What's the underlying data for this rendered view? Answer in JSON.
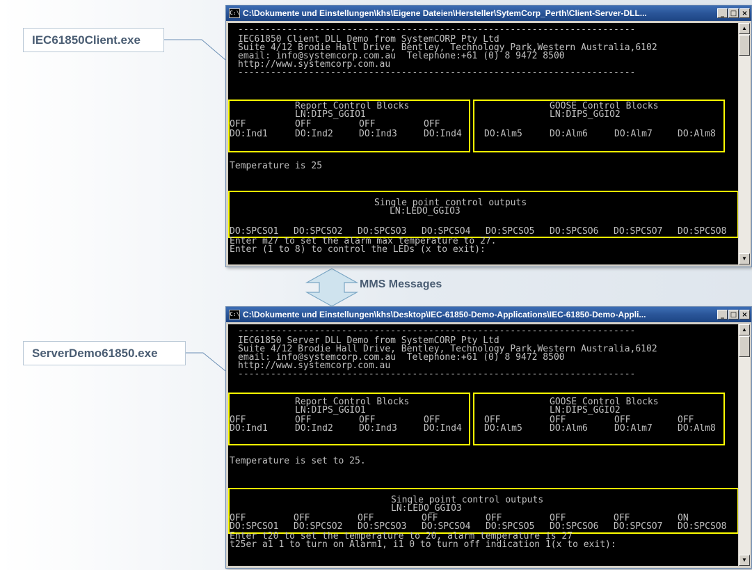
{
  "labels": {
    "client": "IEC61850Client.exe",
    "server": "ServerDemo61850.exe",
    "mms": "MMS Messages"
  },
  "client_window": {
    "title": "C:\\Dokumente und Einstellungen\\khs\\Eigene Dateien\\Hersteller\\SytemCorp_Perth\\Client-Server-DLL...",
    "separator": "-------------------------------------------------------------------------",
    "header": [
      "IEC61850 Client DLL Demo from SystemCORP Pty Ltd",
      "Suite 4/12 Brodie Hall Drive, Bentley, Technology Park,Western Australia,6102",
      "email: info@systemcorp.com.au  Telephone:+61 (0) 8 9472 8500",
      "http://www.systemcorp.com.au"
    ],
    "report_title": "Report Control Blocks",
    "report_ln": "LN:DIPS_GGIO1",
    "report_states": [
      "OFF",
      "OFF",
      "OFF",
      "OFF"
    ],
    "report_dos": [
      "DO:Ind1",
      "DO:Ind2",
      "DO:Ind3",
      "DO:Ind4"
    ],
    "goose_title": "GOOSE Control Blocks",
    "goose_ln": "LN:DIPS_GGIO2",
    "goose_states": [
      "",
      "",
      "",
      ""
    ],
    "goose_dos": [
      "DO:Alm5",
      "DO:Alm6",
      "DO:Alm7",
      "DO:Alm8"
    ],
    "temperature": "Temperature is 25",
    "spc_title": "Single point control outputs",
    "spc_ln": "LN:LEDO_GGIO3",
    "spc_states": [
      "",
      "",
      "",
      "",
      "",
      "",
      "",
      ""
    ],
    "spc_dos": [
      "DO:SPCSO1",
      "DO:SPCSO2",
      "DO:SPCSO3",
      "DO:SPCSO4",
      "DO:SPCSO5",
      "DO:SPCSO6",
      "DO:SPCSO7",
      "DO:SPCSO8"
    ],
    "prompt1": "Enter m27 to set the alarm max temperature to 27.",
    "prompt2": "Enter (1 to 8) to control the LEDs (x to exit):"
  },
  "server_window": {
    "title": "C:\\Dokumente und Einstellungen\\khs\\Desktop\\IEC-61850-Demo-Applications\\IEC-61850-Demo-Appli...",
    "separator": "-------------------------------------------------------------------------",
    "header": [
      "IEC61850 Server DLL Demo from SystemCORP Pty Ltd",
      "Suite 4/12 Brodie Hall Drive, Bentley, Technology Park,Western Australia,6102",
      "email: info@systemcorp.com.au  Telephone:+61 (0) 8 9472 8500",
      "http://www.systemcorp.com.au"
    ],
    "report_title": "Report Control Blocks",
    "report_ln": "LN:DIPS_GGIO1",
    "report_states": [
      "OFF",
      "OFF",
      "OFF",
      "OFF"
    ],
    "report_dos": [
      "DO:Ind1",
      "DO:Ind2",
      "DO:Ind3",
      "DO:Ind4"
    ],
    "goose_title": "GOOSE Control Blocks",
    "goose_ln": "LN:DIPS_GGIO2",
    "goose_states": [
      "OFF",
      "OFF",
      "OFF",
      "OFF"
    ],
    "goose_dos": [
      "DO:Alm5",
      "DO:Alm6",
      "DO:Alm7",
      "DO:Alm8"
    ],
    "temperature": "Temperature is set to 25.",
    "spc_title": "Single point control outputs",
    "spc_ln": "LN:LEDO_GGIO3",
    "spc_states": [
      "OFF",
      "OFF",
      "OFF",
      "OFF",
      "OFF",
      "OFF",
      "OFF",
      "ON"
    ],
    "spc_dos": [
      "DO:SPCSO1",
      "DO:SPCSO2",
      "DO:SPCSO3",
      "DO:SPCSO4",
      "DO:SPCSO5",
      "DO:SPCSO6",
      "DO:SPCSO7",
      "DO:SPCSO8"
    ],
    "prompt1": "Enter t20 to set the temperature to 20, alarm temperature is 27",
    "prompt2": "t25er a1 1 to turn on Alarm1, i1 0 to turn off indication 1(x to exit):"
  },
  "titlebar_buttons": {
    "minimize": "_",
    "maximize": "□",
    "close": "×"
  },
  "colors": {
    "highlight_box": "#ffff00",
    "console_bg": "#000000",
    "console_text": "#c0c0c0",
    "titlebar": "#2a5598"
  }
}
